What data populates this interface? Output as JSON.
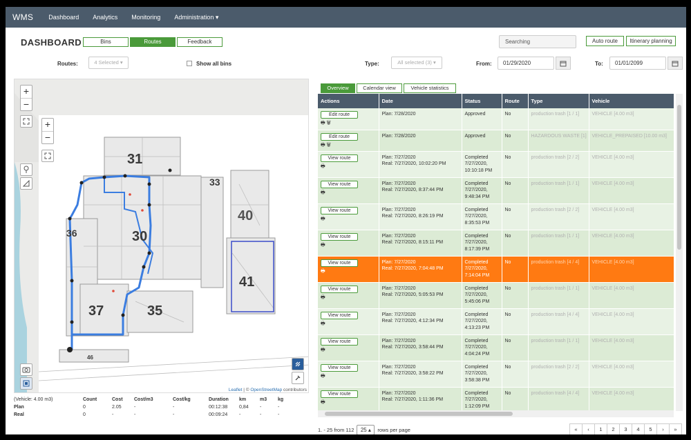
{
  "navbar": {
    "brand": "WMS",
    "items": [
      "Dashboard",
      "Analytics",
      "Monitoring",
      "Administration ▾"
    ]
  },
  "header": {
    "title": "DASHBOARD",
    "tabs": [
      "Bins",
      "Routes",
      "Feedback"
    ],
    "active_tab": "Routes",
    "search_text": "Searching",
    "auto_route": "Auto route",
    "itinerary_planning": "Itinerary planning"
  },
  "filters": {
    "routes_label": "Routes:",
    "routes_value": "4 Selected ▾",
    "show_all_bins": "Show all bins",
    "type_label": "Type:",
    "type_value": "All selected (3) ▾",
    "from_label": "From:",
    "from_value": "01/29/2020",
    "to_label": "To:",
    "to_value": "01/01/2099"
  },
  "map": {
    "zoom_in": "+",
    "zoom_out": "−",
    "attribution_link": "Leaflet",
    "attribution_sep": " | © ",
    "attribution_osm": "OpenStreetMap",
    "attribution_tail": " contributors",
    "buildings": [
      "31",
      "33",
      "36",
      "30",
      "40",
      "41",
      "37",
      "35",
      "46"
    ]
  },
  "map_stats": {
    "vehicle": "(Vehicle: 4.00 m3)",
    "headers": [
      "Count",
      "Cost",
      "Cost/m3",
      "Cost/kg",
      "Duration",
      "km",
      "m3",
      "kg"
    ],
    "rows": [
      {
        "label": "Plan",
        "values": [
          "0",
          "2.05",
          "-",
          "-",
          "00:12:38",
          "0,84",
          "-",
          "-"
        ]
      },
      {
        "label": "Real",
        "values": [
          "0",
          "-",
          "-",
          "-",
          "00:09:24",
          "-",
          "-",
          "-"
        ]
      }
    ]
  },
  "right_tabs": [
    "Overview",
    "Calendar view",
    "Vehicle statistics"
  ],
  "table": {
    "headers": [
      "Actions",
      "Date",
      "Status",
      "Route",
      "Type",
      "Vehicle"
    ],
    "rows": [
      {
        "action": "Edit route",
        "icons": "🖶  🗑",
        "date1": "Plan: 7/28/2020",
        "date2": "",
        "status": "Approved",
        "route": "No",
        "type": "production trash [1 / 1]",
        "vehicle": "VEHICLE [4.00 m3]"
      },
      {
        "action": "Edit route",
        "icons": "🖶  🗑",
        "date1": "Plan: 7/28/2020",
        "date2": "",
        "status": "Approved",
        "route": "No",
        "type": "HAZARDOUS WASTE [1]",
        "vehicle": "VEHICLE_PREPAISED [10.00 m3]"
      },
      {
        "action": "View route",
        "icons": "🖶",
        "date1": "Plan: 7/27/2020",
        "date2": "Real: 7/27/2020, 10:02:20 PM",
        "status": "Completed 7/27/2020, 10:10:18 PM",
        "route": "No",
        "type": "production trash [2 / 2]",
        "vehicle": "VEHICLE [4.00 m3]"
      },
      {
        "action": "View route",
        "icons": "🖶",
        "date1": "Plan: 7/27/2020",
        "date2": "Real: 7/27/2020, 8:37:44 PM",
        "status": "Completed 7/27/2020, 9:48:34 PM",
        "route": "No",
        "type": "production trash [1 / 1]",
        "vehicle": "VEHICLE [4.00 m3]"
      },
      {
        "action": "View route",
        "icons": "🖶",
        "date1": "Plan: 7/27/2020",
        "date2": "Real: 7/27/2020, 8:26:19 PM",
        "status": "Completed 7/27/2020, 8:35:53 PM",
        "route": "No",
        "type": "production trash [2 / 2]",
        "vehicle": "VEHICLE [4.00 m3]"
      },
      {
        "action": "View route",
        "icons": "🖶",
        "date1": "Plan: 7/27/2020",
        "date2": "Real: 7/27/2020, 8:15:11 PM",
        "status": "Completed 7/27/2020, 8:17:39 PM",
        "route": "No",
        "type": "production trash [1 / 1]",
        "vehicle": "VEHICLE [4.00 m3]"
      },
      {
        "action": "View route",
        "icons": "🖶",
        "date1": "Plan: 7/27/2020",
        "date2": "Real: 7/27/2020, 7:04:48 PM",
        "status": "Completed 7/27/2020, 7:14:04 PM",
        "route": "No",
        "type": "production trash [4 / 4]",
        "vehicle": "VEHICLE [4.00 m3]",
        "selected": true
      },
      {
        "action": "View route",
        "icons": "🖶",
        "date1": "Plan: 7/27/2020",
        "date2": "Real: 7/27/2020, 5:05:53 PM",
        "status": "Completed 7/27/2020, 5:45:06 PM",
        "route": "No",
        "type": "production trash [1 / 1]",
        "vehicle": "VEHICLE [4.00 m3]"
      },
      {
        "action": "View route",
        "icons": "🖶",
        "date1": "Plan: 7/27/2020",
        "date2": "Real: 7/27/2020, 4:12:34 PM",
        "status": "Completed 7/27/2020, 4:13:23 PM",
        "route": "No",
        "type": "production trash [4 / 4]",
        "vehicle": "VEHICLE [4.00 m3]"
      },
      {
        "action": "View route",
        "icons": "🖶",
        "date1": "Plan: 7/27/2020",
        "date2": "Real: 7/27/2020, 3:58:44 PM",
        "status": "Completed 7/27/2020, 4:04:24 PM",
        "route": "No",
        "type": "production trash [1 / 1]",
        "vehicle": "VEHICLE [4.00 m3]"
      },
      {
        "action": "View route",
        "icons": "🖶",
        "date1": "Plan: 7/27/2020",
        "date2": "Real: 7/27/2020, 3:58:22 PM",
        "status": "Completed 7/27/2020, 3:58:38 PM",
        "route": "No",
        "type": "production trash [2 / 2]",
        "vehicle": "VEHICLE [4.00 m3]"
      },
      {
        "action": "View route",
        "icons": "🖶",
        "date1": "Plan: 7/27/2020",
        "date2": "Real: 7/27/2020, 1:11:36 PM",
        "status": "Completed 7/27/2020, 1:12:09 PM",
        "route": "No",
        "type": "production trash [4 / 4]",
        "vehicle": "VEHICLE [4.00 m3]"
      }
    ]
  },
  "pagination": {
    "range_text": "1. - 25 from 112",
    "per_page": "25 ▴",
    "per_page_label": "rows per page",
    "buttons": [
      "«",
      "‹",
      "1",
      "2",
      "3",
      "4",
      "5",
      "›",
      "»"
    ]
  },
  "colors": {
    "navbar": "#4b5b6b",
    "accent_green": "#4a9a3a",
    "selected_row": "#ff7a12",
    "route_line": "#3b7de0"
  }
}
